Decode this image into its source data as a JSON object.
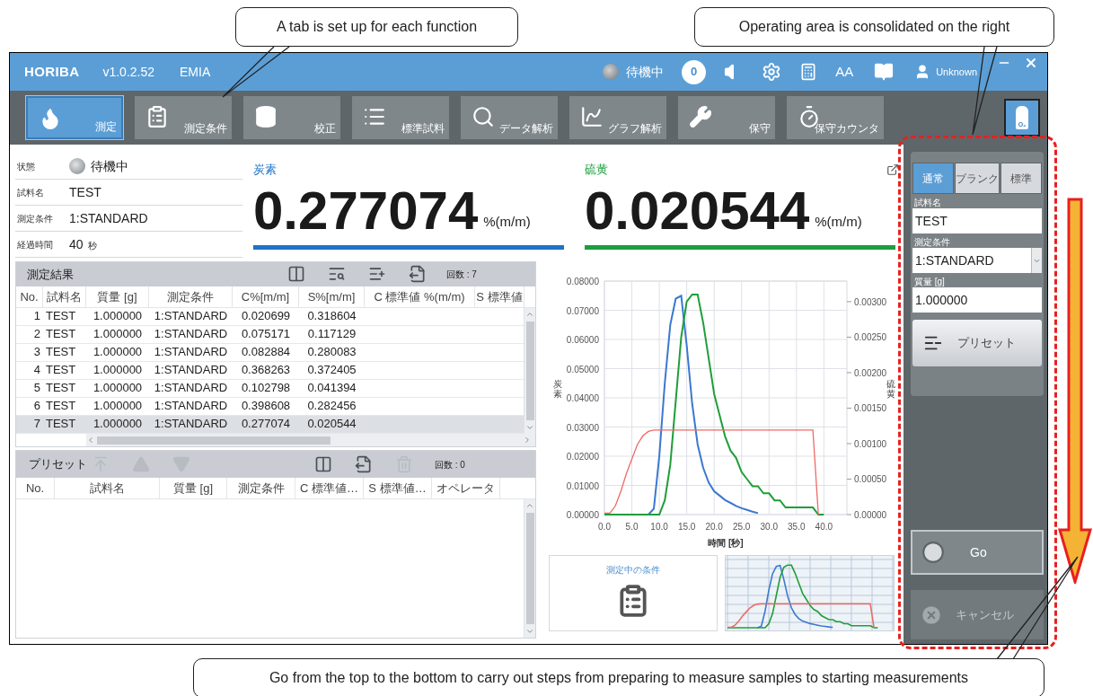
{
  "annotations": {
    "callouts": [
      {
        "text": "A tab is set up for each function"
      },
      {
        "text": "Operating area is consolidated on the right"
      },
      {
        "text": "Go from the top to the bottom to carry out steps from preparing to measure samples to starting measurements"
      }
    ]
  },
  "title_bar": {
    "logo": "HORIBA",
    "version": "v1.0.2.52",
    "product": "EMIA",
    "status": "待機中",
    "notification_count": "0",
    "font_size_label": "AA",
    "user": "Unknown"
  },
  "function_tabs": [
    {
      "label": "測定",
      "kind": "flame",
      "selected": true
    },
    {
      "label": "測定条件",
      "kind": "clipboard",
      "selected": false
    },
    {
      "label": "校正",
      "kind": "cylinder",
      "selected": false
    },
    {
      "label": "標準試料",
      "kind": "list",
      "selected": false
    },
    {
      "label": "データ解析",
      "kind": "data",
      "selected": false
    },
    {
      "label": "グラフ解析",
      "kind": "graph",
      "selected": false
    },
    {
      "label": "保守",
      "kind": "wrench",
      "selected": false
    },
    {
      "label": "保守カウンタ",
      "kind": "timer",
      "selected": false
    }
  ],
  "gas_button": {
    "label": "O₂"
  },
  "status_info": [
    {
      "label": "状態",
      "value": "待機中",
      "kind": "lamp"
    },
    {
      "label": "試料名",
      "value": "TEST",
      "kind": "text"
    },
    {
      "label": "測定条件",
      "value": "1:STANDARD",
      "kind": "text"
    },
    {
      "label": "経過時間",
      "value": "40",
      "unit": "秒",
      "kind": "text"
    }
  ],
  "readouts": [
    {
      "element": "炭素",
      "value": "0.277074",
      "unit": "%(m/m)",
      "color": "#1f72c4"
    },
    {
      "element": "硫黄",
      "value": "0.020544",
      "unit": "%(m/m)",
      "color": "#1b9e3e"
    }
  ],
  "results": {
    "title": "測定結果",
    "count": "回数 : 7",
    "tools": [
      {
        "kind": "columns",
        "disabled": false
      },
      {
        "kind": "search",
        "disabled": false
      },
      {
        "kind": "add",
        "disabled": false
      },
      {
        "kind": "export",
        "disabled": false
      }
    ],
    "columns": [
      "No.",
      "試料名",
      "質量 [g]",
      "測定条件",
      "C%[m/m]",
      "S%[m/m]",
      "C 標準値 %(m/m)",
      "S 標準値"
    ],
    "rows": [
      {
        "cells": [
          "1",
          "TEST",
          "1.000000",
          "1:STANDARD",
          "0.020699",
          "0.318604"
        ],
        "selected": false
      },
      {
        "cells": [
          "2",
          "TEST",
          "1.000000",
          "1:STANDARD",
          "0.075171",
          "0.117129"
        ],
        "selected": false
      },
      {
        "cells": [
          "3",
          "TEST",
          "1.000000",
          "1:STANDARD",
          "0.082884",
          "0.280083"
        ],
        "selected": false
      },
      {
        "cells": [
          "4",
          "TEST",
          "1.000000",
          "1:STANDARD",
          "0.368263",
          "0.372405"
        ],
        "selected": false
      },
      {
        "cells": [
          "5",
          "TEST",
          "1.000000",
          "1:STANDARD",
          "0.102798",
          "0.041394"
        ],
        "selected": false
      },
      {
        "cells": [
          "6",
          "TEST",
          "1.000000",
          "1:STANDARD",
          "0.398608",
          "0.282456"
        ],
        "selected": false
      },
      {
        "cells": [
          "7",
          "TEST",
          "1.000000",
          "1:STANDARD",
          "0.277074",
          "0.020544"
        ],
        "selected": true
      }
    ]
  },
  "preset": {
    "title": "プリセット",
    "count": "回数 : 0",
    "move_tools": [
      {
        "kind": "top",
        "disabled": true
      },
      {
        "kind": "up",
        "disabled": true
      },
      {
        "kind": "down",
        "disabled": true
      }
    ],
    "tools": [
      {
        "kind": "columns",
        "disabled": false
      },
      {
        "kind": "export",
        "disabled": false
      },
      {
        "kind": "delete",
        "disabled": true
      }
    ],
    "columns": [
      "No.",
      "試料名",
      "質量 [g]",
      "測定条件",
      "C 標準値…",
      "S 標準値…",
      "オペレータ"
    ]
  },
  "chart": {
    "chart_data": {
      "type": "line",
      "grid": true,
      "xlabel": "時間 [秒]",
      "ylabel": "炭素",
      "y2label": "硫黄",
      "xlim": [
        0,
        44.2
      ],
      "ylim": [
        0,
        0.08
      ],
      "y2lim": [
        0,
        0.00329
      ],
      "xticks": [
        {
          "value": 0,
          "label": "0.0"
        },
        {
          "value": 5,
          "label": "5.0"
        },
        {
          "value": 10,
          "label": "10.0"
        },
        {
          "value": 15,
          "label": "15.0"
        },
        {
          "value": 20,
          "label": "20.0"
        },
        {
          "value": 25,
          "label": "25.0"
        },
        {
          "value": 30,
          "label": "30.0"
        },
        {
          "value": 35,
          "label": "35.0"
        },
        {
          "value": 40,
          "label": "40.0"
        }
      ],
      "yticks": [
        {
          "value": 0,
          "label": "0.00000"
        },
        {
          "value": 0.01,
          "label": "0.01000"
        },
        {
          "value": 0.02,
          "label": "0.02000"
        },
        {
          "value": 0.03,
          "label": "0.03000"
        },
        {
          "value": 0.04,
          "label": "0.04000"
        },
        {
          "value": 0.05,
          "label": "0.05000"
        },
        {
          "value": 0.06,
          "label": "0.06000"
        },
        {
          "value": 0.07,
          "label": "0.07000"
        },
        {
          "value": 0.08,
          "label": "0.08000"
        }
      ],
      "y2ticks": [
        {
          "value": 0,
          "label": "0.00000"
        },
        {
          "value": 0.0005,
          "label": "0.00050"
        },
        {
          "value": 0.001,
          "label": "0.00100"
        },
        {
          "value": 0.0015,
          "label": "0.00150"
        },
        {
          "value": 0.002,
          "label": "0.00200"
        },
        {
          "value": 0.0025,
          "label": "0.00250"
        },
        {
          "value": 0.003,
          "label": "0.00300"
        }
      ],
      "x": [
        0,
        1,
        2,
        3,
        4,
        5,
        6,
        7,
        8,
        9,
        10,
        11,
        12,
        13,
        14,
        15,
        16,
        17,
        18,
        19,
        20,
        21,
        22,
        23,
        24,
        25,
        26,
        27,
        28,
        29,
        30,
        31,
        32,
        33,
        34,
        35,
        36,
        37,
        38,
        39,
        40
      ],
      "series": [
        {
          "color": "#3a78d0",
          "values": [
            null,
            null,
            null,
            null,
            null,
            null,
            null,
            null,
            0,
            0.002,
            0.02,
            0.045,
            0.065,
            0.074,
            0.075,
            0.058,
            0.038,
            0.024,
            0.016,
            0.011,
            0.008,
            0.0065,
            0.005,
            0.004,
            0.003,
            0.0022,
            0.0016,
            0.001,
            0.0005,
            null,
            null,
            null,
            null,
            null,
            null,
            null,
            null,
            null,
            null,
            null,
            null
          ]
        },
        {
          "color": "#1f9e3a",
          "axis": "y2",
          "values": [
            0,
            0,
            0,
            0,
            0,
            0,
            0,
            0,
            0,
            0,
            0,
            0.0002,
            0.0007,
            0.0016,
            0.0025,
            0.003,
            0.0031,
            0.0031,
            0.0027,
            0.0022,
            0.0017,
            0.0014,
            0.0011,
            0.0009,
            0.0008,
            0.0006,
            0.0005,
            0.0004,
            0.0004,
            0.0003,
            0.0003,
            0.0002,
            0.0002,
            0.0001,
            0.0001,
            0.0001,
            0.0001,
            0.0001,
            0.0001,
            0,
            0
          ]
        },
        {
          "color": "#ee6a66",
          "values": [
            0.0005,
            0.0005,
            0.003,
            0.008,
            0.014,
            0.019,
            0.024,
            0.027,
            0.0285,
            0.029,
            0.029,
            0.029,
            0.029,
            0.029,
            0.029,
            0.029,
            0.029,
            0.029,
            0.029,
            0.029,
            0.029,
            0.029,
            0.029,
            0.029,
            0.029,
            0.029,
            0.029,
            0.029,
            0.029,
            0.029,
            0.029,
            0.029,
            0.029,
            0.029,
            0.029,
            0.029,
            0.029,
            0.029,
            0.029,
            0,
            null
          ]
        }
      ]
    }
  },
  "condition_panel": {
    "title": "測定中の条件"
  },
  "operation_panel": {
    "modes": [
      {
        "label": "通常",
        "selected": true
      },
      {
        "label": "ブランク",
        "selected": false
      },
      {
        "label": "標準",
        "selected": false
      }
    ],
    "fields": [
      {
        "label": "試料名",
        "value": "TEST",
        "kind": "text"
      },
      {
        "label": "測定条件",
        "value": "1:STANDARD",
        "kind": "select"
      },
      {
        "label": "質量 [g]",
        "value": "1.000000",
        "kind": "text"
      }
    ],
    "preset_button": "プリセット",
    "go_button": {
      "label": "Go",
      "disabled": false
    },
    "cancel_button": {
      "label": "キャンセル",
      "disabled": true
    }
  }
}
